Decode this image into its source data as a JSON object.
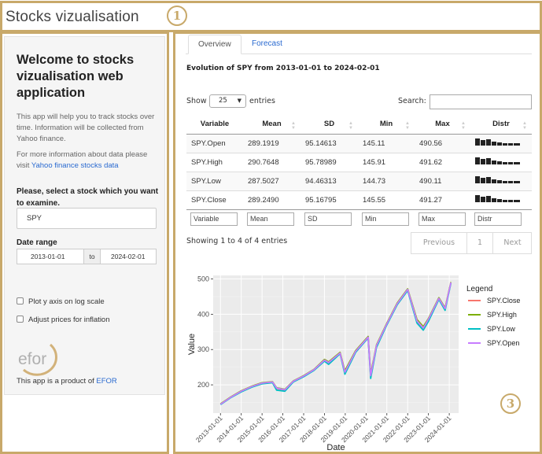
{
  "header": {
    "title": "Stocks vizualisation"
  },
  "badges": {
    "b1": "1",
    "b2": "2",
    "b3": "3"
  },
  "sidebar": {
    "heading": "Welcome to stocks vizualisation web application",
    "intro": "This app will help you to track stocks over time. Information will be collected from Yahoo finance.",
    "more_info": "For more information about data please visit",
    "more_info_link": "Yahoo finance stocks data",
    "select_label": "Please, select a stock which you want to examine.",
    "stock_value": "SPY",
    "date_range_label": "Date range",
    "date_start": "2013-01-01",
    "date_sep": "to",
    "date_end": "2024-02-01",
    "log_label": "Plot y axis on log scale",
    "inflation_label": "Adjust prices for inflation",
    "logo_text": "efor",
    "product_text": "This app is a product of",
    "product_link": "EFOR"
  },
  "tabs": [
    {
      "label": "Overview",
      "active": true
    },
    {
      "label": "Forecast",
      "active": false
    }
  ],
  "main": {
    "heading": "Evolution of SPY from 2013-01-01 to 2024-02-01",
    "show_label": "Show",
    "length_value": "25",
    "entries_label": "entries",
    "search_label": "Search:",
    "info": "Showing 1 to 4 of 4 entries",
    "pager": {
      "prev": "Previous",
      "page": "1",
      "next": "Next"
    }
  },
  "table": {
    "columns": [
      "Variable",
      "Mean",
      "SD",
      "Min",
      "Max",
      "Distr"
    ],
    "rows": [
      [
        "SPY.Open",
        "289.1919",
        "95.14613",
        "145.11",
        "490.56"
      ],
      [
        "SPY.High",
        "290.7648",
        "95.78989",
        "145.91",
        "491.62"
      ],
      [
        "SPY.Low",
        "287.5027",
        "94.46313",
        "144.73",
        "490.11"
      ],
      [
        "SPY.Close",
        "289.2490",
        "95.16795",
        "145.55",
        "491.27"
      ]
    ],
    "filters": [
      "Variable",
      "Mean",
      "SD",
      "Min",
      "Max",
      "Distr"
    ]
  },
  "chart_data": {
    "type": "line",
    "xlabel": "Date",
    "ylabel": "Value",
    "legend_title": "Legend",
    "legend_position": "right",
    "ylim": [
      120,
      510
    ],
    "y_ticks": [
      200,
      300,
      400,
      500
    ],
    "x_ticks": [
      "2013-01-01",
      "2014-01-01",
      "2015-01-01",
      "2016-01-01",
      "2017-01-01",
      "2018-01-01",
      "2019-01-01",
      "2020-01-01",
      "2021-01-01",
      "2022-01-01",
      "2023-01-01",
      "2024-01-01"
    ],
    "colors": {
      "SPY.Close": "#f8766d",
      "SPY.High": "#7cae00",
      "SPY.Low": "#00bfc4",
      "SPY.Open": "#c77cff"
    },
    "series": [
      {
        "name": "SPY.Close",
        "x": [
          2013.0,
          2013.5,
          2014.0,
          2014.5,
          2015.0,
          2015.5,
          2015.7,
          2016.1,
          2016.5,
          2017.0,
          2017.5,
          2018.0,
          2018.2,
          2018.75,
          2018.98,
          2019.5,
          2020.1,
          2020.22,
          2020.5,
          2021.0,
          2021.5,
          2022.0,
          2022.45,
          2022.75,
          2023.0,
          2023.5,
          2023.8,
          2024.08
        ],
        "y": [
          145,
          165,
          182,
          195,
          205,
          208,
          190,
          185,
          210,
          225,
          243,
          270,
          262,
          290,
          235,
          295,
          335,
          225,
          310,
          373,
          430,
          470,
          380,
          360,
          385,
          445,
          415,
          490
        ]
      },
      {
        "name": "SPY.High",
        "x": [
          2013.0,
          2013.5,
          2014.0,
          2014.5,
          2015.0,
          2015.5,
          2015.7,
          2016.1,
          2016.5,
          2017.0,
          2017.5,
          2018.0,
          2018.2,
          2018.75,
          2018.98,
          2019.5,
          2020.1,
          2020.22,
          2020.5,
          2021.0,
          2021.5,
          2022.0,
          2022.45,
          2022.75,
          2023.0,
          2023.5,
          2023.8,
          2024.08
        ],
        "y": [
          146,
          166,
          183,
          196,
          206,
          209,
          192,
          187,
          211,
          226,
          244,
          272,
          265,
          292,
          240,
          297,
          337,
          230,
          313,
          375,
          432,
          472,
          385,
          365,
          388,
          447,
          418,
          491
        ]
      },
      {
        "name": "SPY.Low",
        "x": [
          2013.0,
          2013.5,
          2014.0,
          2014.5,
          2015.0,
          2015.5,
          2015.7,
          2016.1,
          2016.5,
          2017.0,
          2017.5,
          2018.0,
          2018.2,
          2018.75,
          2018.98,
          2019.5,
          2020.1,
          2020.22,
          2020.5,
          2021.0,
          2021.5,
          2022.0,
          2022.45,
          2022.75,
          2023.0,
          2023.5,
          2023.8,
          2024.08
        ],
        "y": [
          144,
          164,
          180,
          193,
          203,
          206,
          185,
          182,
          208,
          223,
          241,
          267,
          258,
          288,
          230,
          292,
          333,
          218,
          306,
          370,
          427,
          467,
          375,
          355,
          380,
          442,
          411,
          488
        ]
      },
      {
        "name": "SPY.Open",
        "x": [
          2013.0,
          2013.5,
          2014.0,
          2014.5,
          2015.0,
          2015.5,
          2015.7,
          2016.1,
          2016.5,
          2017.0,
          2017.5,
          2018.0,
          2018.2,
          2018.75,
          2018.98,
          2019.5,
          2020.1,
          2020.22,
          2020.5,
          2021.0,
          2021.5,
          2022.0,
          2022.45,
          2022.75,
          2023.0,
          2023.5,
          2023.8,
          2024.08
        ],
        "y": [
          145,
          165,
          182,
          195,
          205,
          208,
          191,
          186,
          210,
          225,
          243,
          270,
          263,
          290,
          236,
          295,
          335,
          226,
          311,
          373,
          430,
          470,
          381,
          361,
          386,
          445,
          416,
          490
        ]
      }
    ]
  }
}
